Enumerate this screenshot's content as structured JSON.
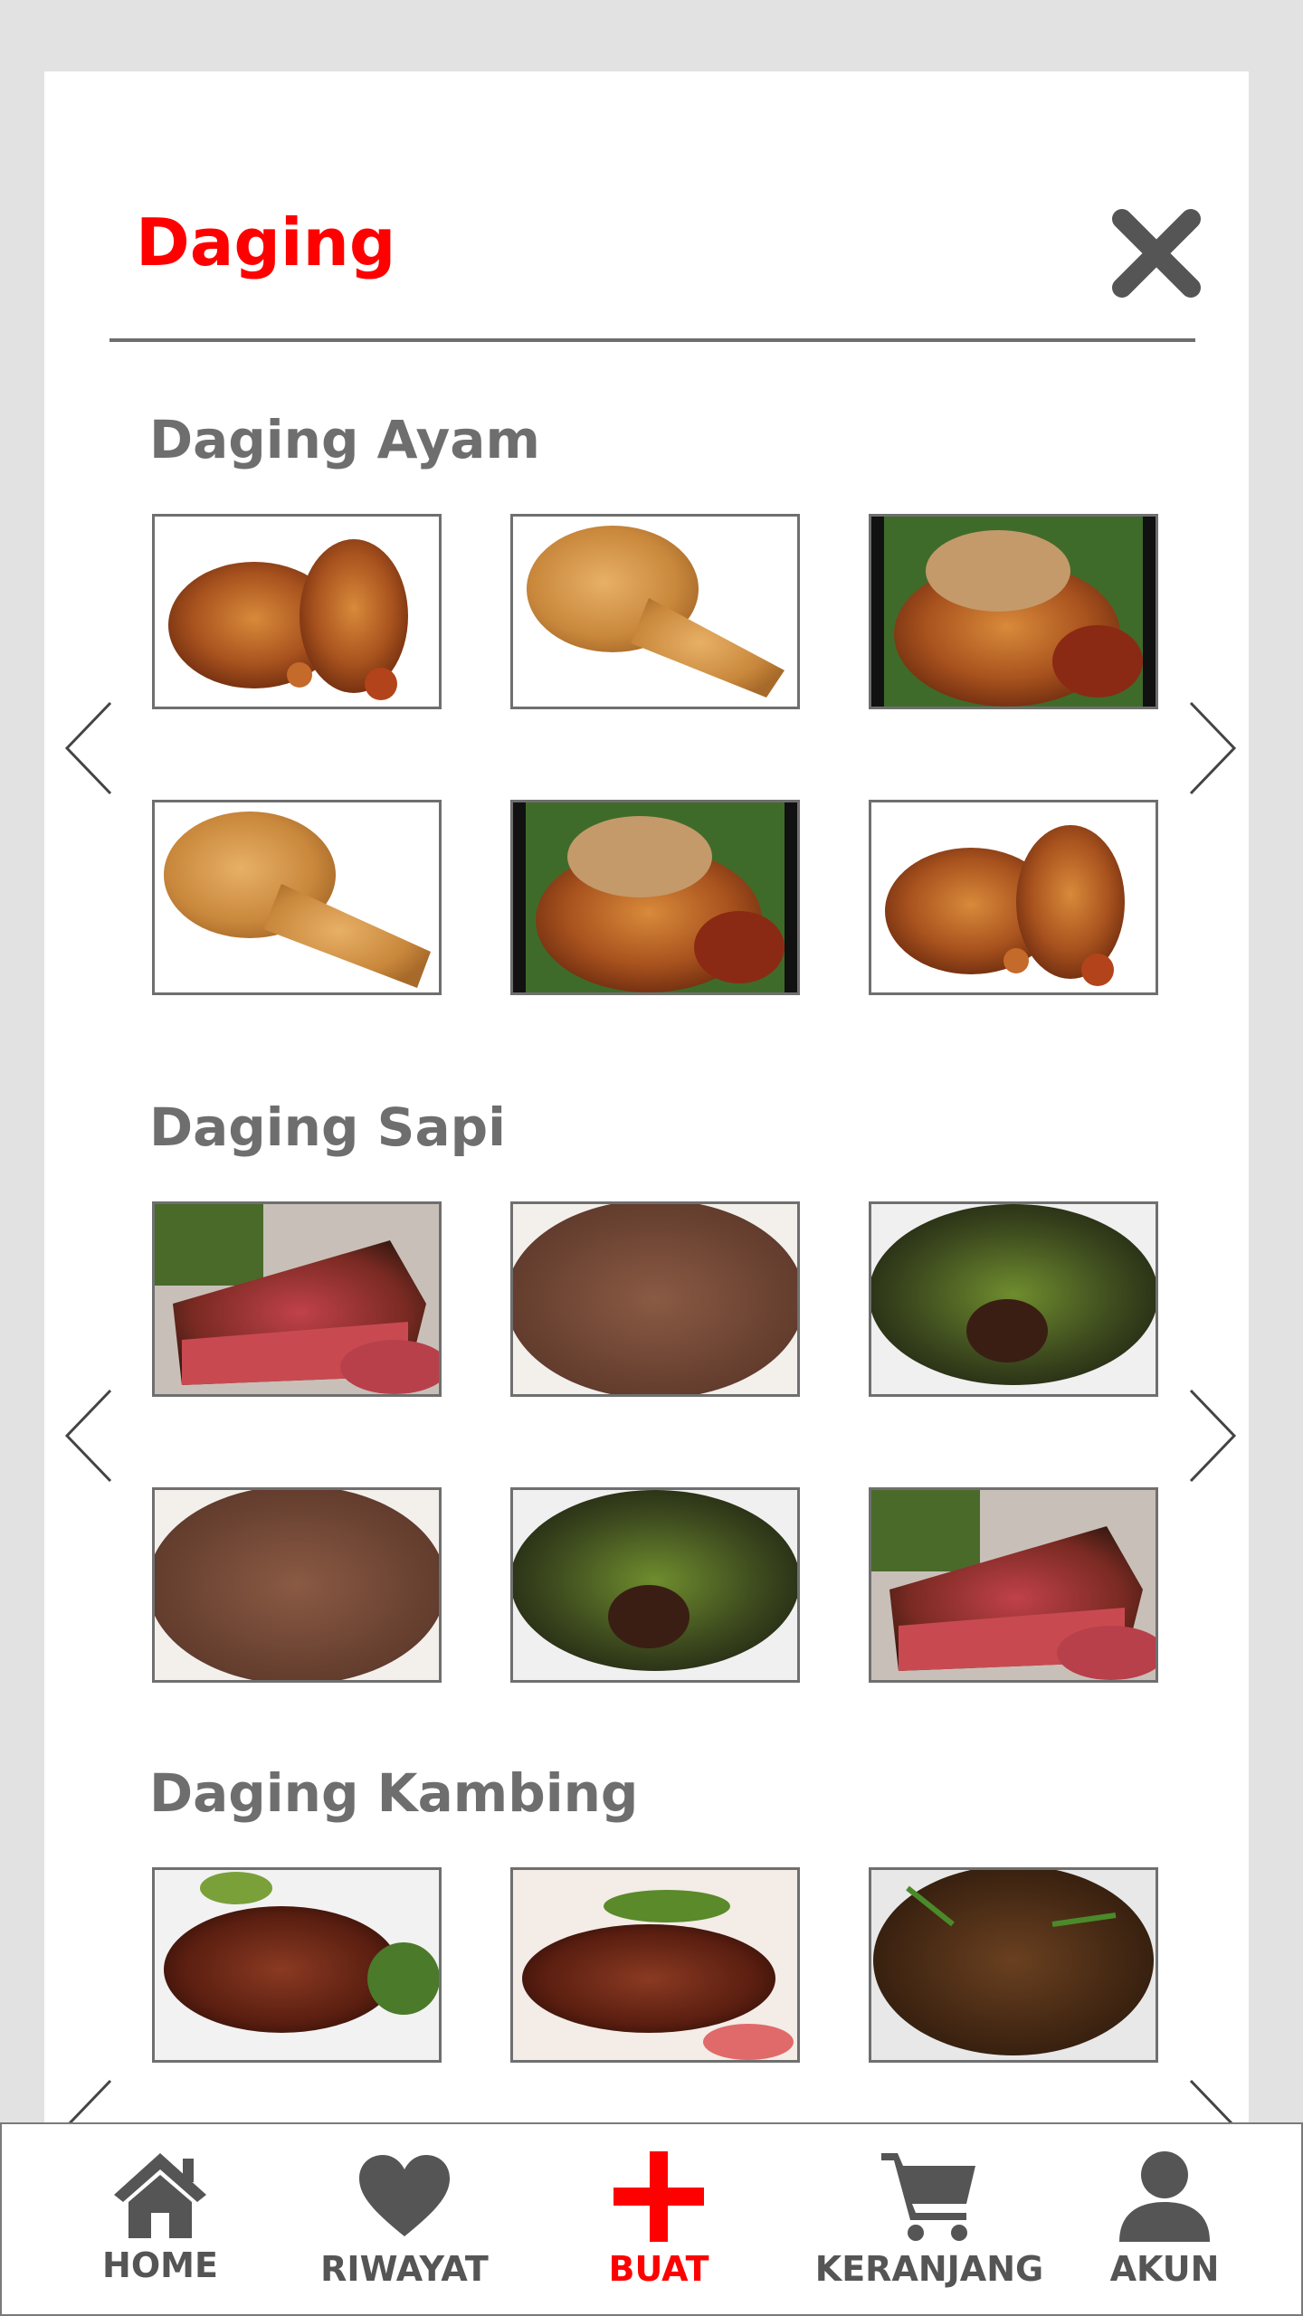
{
  "header": {
    "title": "Daging"
  },
  "sections": [
    {
      "title": "Daging Ayam"
    },
    {
      "title": "Daging Sapi"
    },
    {
      "title": "Daging Kambing"
    }
  ],
  "colors": {
    "accent": "#ff0000",
    "text_gray": "#6e6e6e",
    "icon_gray": "#555555"
  },
  "nav": {
    "home": "HOME",
    "riwayat": "RIWAYAT",
    "buat": "BUAT",
    "keranjang": "KERANJANG",
    "akun": "AKUN",
    "active": "buat"
  }
}
